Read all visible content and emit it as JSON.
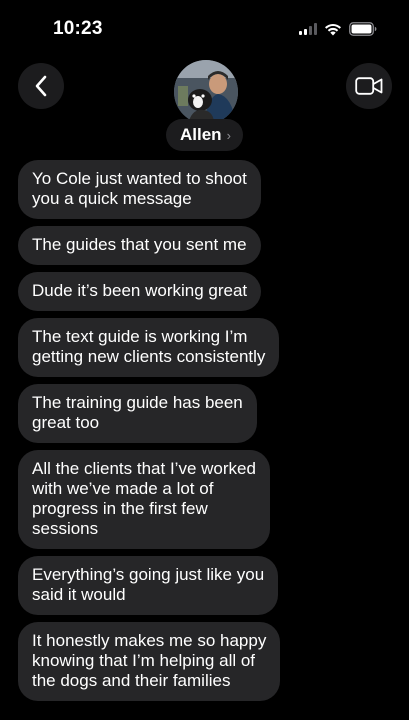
{
  "status_bar": {
    "time": "10:23",
    "icons": [
      "signal-icon",
      "wifi-icon",
      "battery-icon"
    ]
  },
  "header": {
    "back_icon": "chevron-left-icon",
    "video_icon": "video-camera-icon",
    "contact_name": "Allen",
    "name_chevron": "›"
  },
  "messages": [
    {
      "text": "Yo Cole just wanted to shoot\nyou a quick message"
    },
    {
      "text": "The guides that you sent me"
    },
    {
      "text": "Dude it’s been working great"
    },
    {
      "text": "The text guide is working I’m\ngetting new clients consistently"
    },
    {
      "text": "The training guide has been\ngreat too"
    },
    {
      "text": "All the clients that I’ve worked\nwith we’ve made a lot of\nprogress in the first few\nsessions"
    },
    {
      "text": "Everything’s going just like you\nsaid it would"
    },
    {
      "text": "It honestly makes me so happy\nknowing that I’m helping all of\nthe dogs and their families"
    }
  ],
  "colors": {
    "background": "#000000",
    "bubble": "#262628",
    "button_bg": "#1c1c1e"
  }
}
